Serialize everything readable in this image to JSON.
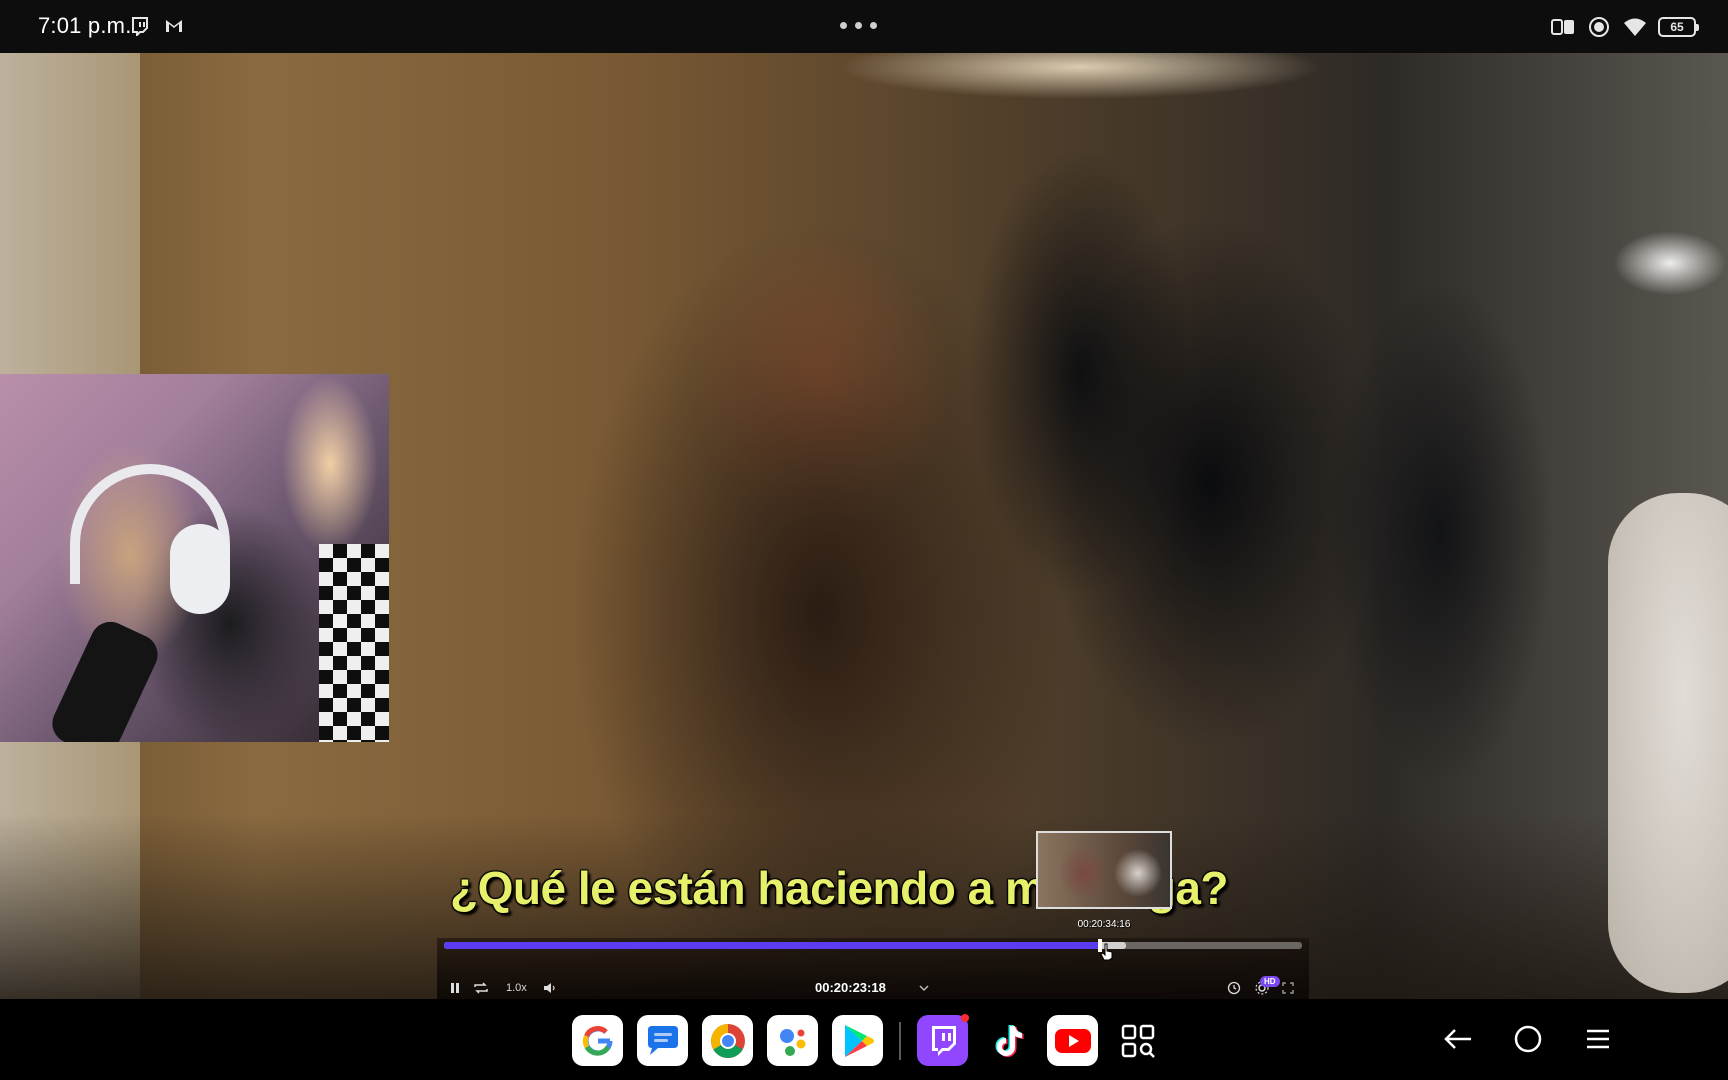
{
  "status_bar": {
    "time": "7:01 p.m.",
    "notification_icons": [
      "twitch-icon",
      "gmail-icon"
    ],
    "overflow": "more-dots-icon",
    "system_icons": [
      "reading-mode-icon",
      "screen-record-icon",
      "wifi-icon"
    ],
    "battery": "65"
  },
  "video": {
    "subtitle": "¿Qué le están haciendo a mi amiga?",
    "seek_preview_time": "00:20:34:16",
    "progress_played_fraction": 0.765,
    "progress_buffered_fraction": 0.795
  },
  "player": {
    "speed": "1.0x",
    "current_time": "00:20:23:18",
    "quality_badge": "HD",
    "controls": [
      "pause-icon",
      "loop-icon",
      "volume-icon",
      "chevron-down-icon",
      "timer-icon",
      "settings-icon",
      "fullscreen-icon"
    ]
  },
  "dock": {
    "apps": [
      {
        "name": "Google",
        "icon": "google-icon"
      },
      {
        "name": "Messages",
        "icon": "messages-icon"
      },
      {
        "name": "Chrome",
        "icon": "chrome-icon"
      },
      {
        "name": "Google Assistant",
        "icon": "assistant-icon"
      },
      {
        "name": "Play Store",
        "icon": "play-store-icon"
      },
      {
        "name": "Twitch",
        "icon": "twitch-icon"
      },
      {
        "name": "TikTok",
        "icon": "tiktok-icon"
      },
      {
        "name": "YouTube",
        "icon": "youtube-icon"
      },
      {
        "name": "App drawer",
        "icon": "app-drawer-icon"
      }
    ],
    "nav_buttons": [
      "back-icon",
      "home-icon",
      "recents-icon"
    ]
  },
  "colors": {
    "subtitle": "#e7f06a",
    "progress_played": "#5b3cf0",
    "twitch": "#9146ff",
    "youtube": "#ff0000"
  }
}
